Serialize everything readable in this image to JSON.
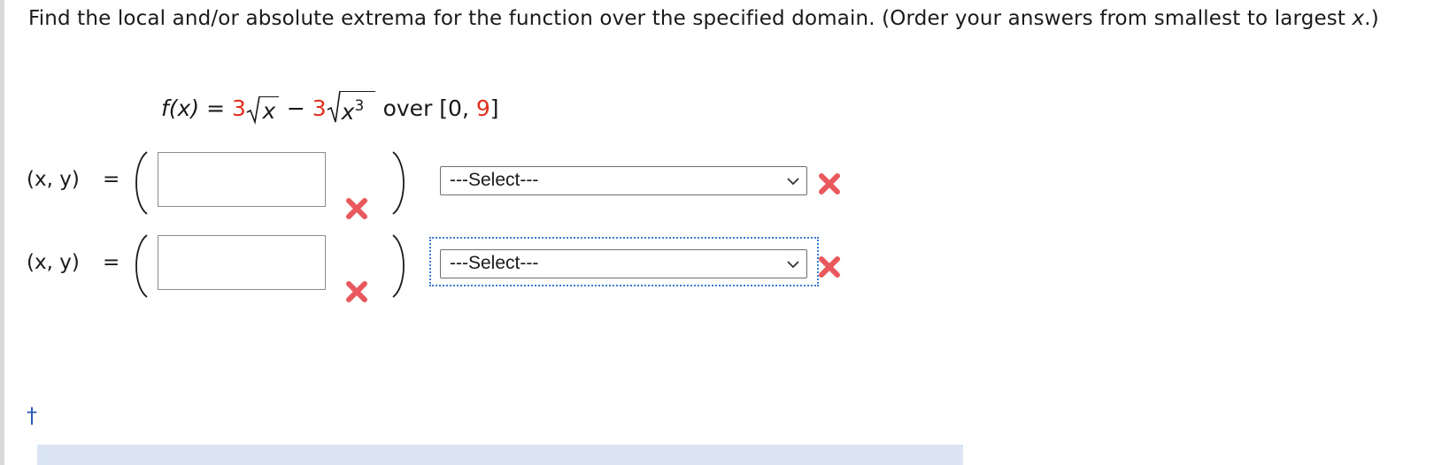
{
  "question": {
    "text_before": "Find the local and/or absolute extrema for the function over the specified domain. (Order your answers from smallest to largest ",
    "var_x": "x",
    "text_after": ".)"
  },
  "formula": {
    "lhs": "f(x)",
    "equals": "=",
    "coef1": "3",
    "radicand1": "x",
    "minus": "−",
    "coef2": "3",
    "radicand2_base": "x",
    "radicand2_exp": "3",
    "over": "over",
    "domain_open": "[0,",
    "domain_end": "9",
    "domain_close": "]"
  },
  "rows": [
    {
      "label": "(x, y)",
      "equals": "=",
      "value": "",
      "select": "---Select---"
    },
    {
      "label": "(x, y)",
      "equals": "=",
      "value": "",
      "select": "---Select---"
    }
  ],
  "footer": {
    "dagger": "†"
  },
  "colors": {
    "highlight_red": "#e0301e",
    "error_x": "#e8585c",
    "focus_blue": "#3a7bd5",
    "link_blue": "#2b5db8"
  },
  "icons": {
    "error": "x-mark-icon",
    "dropdown": "chevron-down-icon"
  }
}
